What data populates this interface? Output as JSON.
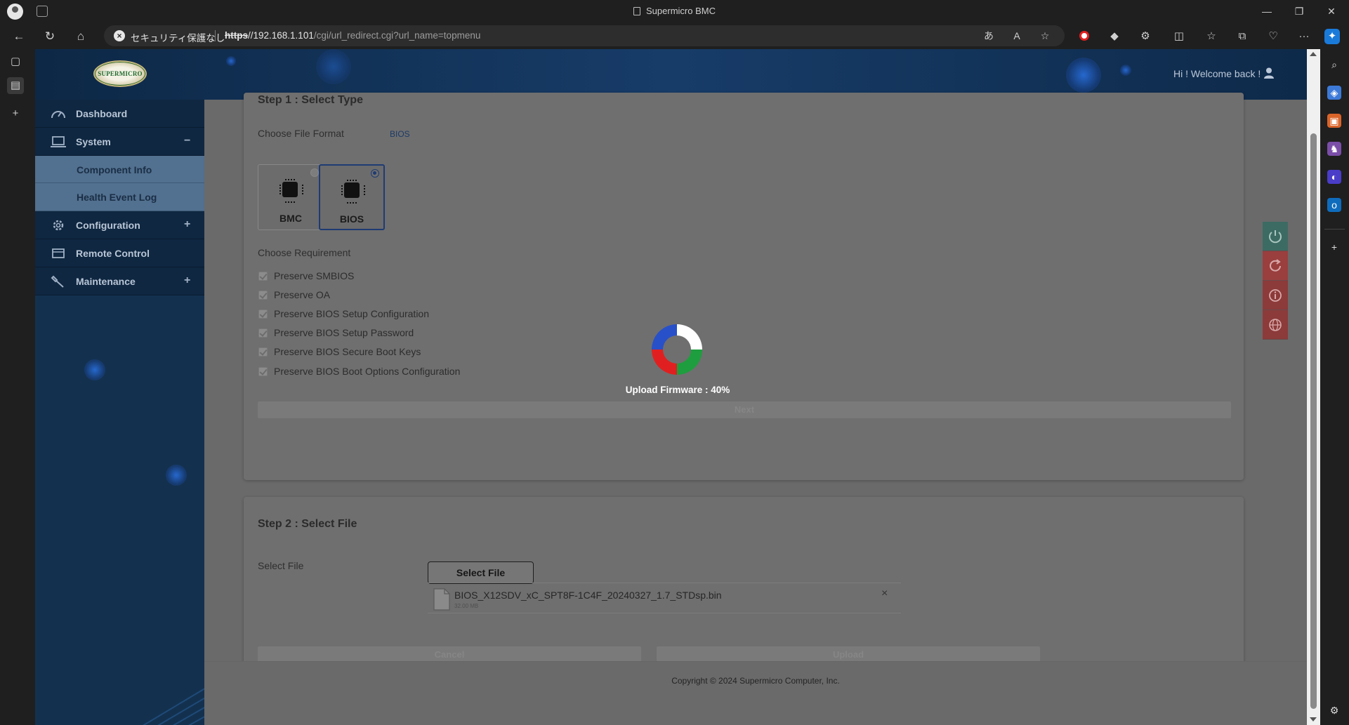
{
  "browser": {
    "window_title": "Supermicro BMC",
    "security_label": "セキュリティ保護なし",
    "url_scheme": "https",
    "url_host": "//192.168.1.101",
    "url_path": "/cgi/url_redirect.cgi?url_name=topmenu"
  },
  "header": {
    "logo_text": "SUPERMICRO",
    "welcome": "Hi ! Welcome back !"
  },
  "sidebar": {
    "items": [
      {
        "label": "Dashboard",
        "icon": "dashboard-gauge-icon"
      },
      {
        "label": "System",
        "icon": "laptop-icon",
        "toggle": "−"
      },
      {
        "label": "Component Info"
      },
      {
        "label": "Health Event Log"
      },
      {
        "label": "Configuration",
        "icon": "gear-icon",
        "toggle": "+"
      },
      {
        "label": "Remote Control",
        "icon": "monitor-icon"
      },
      {
        "label": "Maintenance",
        "icon": "wrench-icon",
        "toggle": "+"
      }
    ]
  },
  "step1": {
    "title": "Step 1 : Select Type",
    "file_format_label": "Choose File Format",
    "file_format_value": "BIOS",
    "types": [
      {
        "name": "BMC",
        "selected": false
      },
      {
        "name": "BIOS",
        "selected": true
      }
    ],
    "requirement_label": "Choose Requirement",
    "requirements": [
      "Preserve SMBIOS",
      "Preserve OA",
      "Preserve BIOS Setup Configuration",
      "Preserve BIOS Setup Password",
      "Preserve BIOS Secure Boot Keys",
      "Preserve BIOS Boot Options Configuration"
    ],
    "next_label": "Next"
  },
  "step2": {
    "title": "Step 2 : Select File",
    "select_file_label": "Select File",
    "select_file_button": "Select File",
    "file_name": "BIOS_X12SDV_xC_SPT8F-1C4F_20240327_1.7_STDsp.bin",
    "file_size": "32.00 MB",
    "file_remove": "×",
    "cancel_label": "Cancel",
    "upload_label": "Upload"
  },
  "overlay": {
    "status": "Upload Firmware : 40%",
    "progress_percent": 40
  },
  "footer": {
    "copyright": "Copyright © 2024 Supermicro Computer, Inc."
  },
  "power_panel": {
    "buttons": [
      "power-icon",
      "reset-icon",
      "info-icon",
      "globe-icon"
    ],
    "colors": {
      "power": "#3c6b63",
      "reset": "#9a3e3e",
      "info": "#8c3a3a",
      "globe": "#8c3a3a"
    }
  },
  "colors": {
    "header_bg": "#173c68",
    "sidebar_bg": "#13314f",
    "submenu_bg": "#52708f",
    "selected_border": "#1e3b73",
    "spinner": [
      "#ffffff",
      "#1e9e3e",
      "#e02020",
      "#2850c8"
    ]
  }
}
